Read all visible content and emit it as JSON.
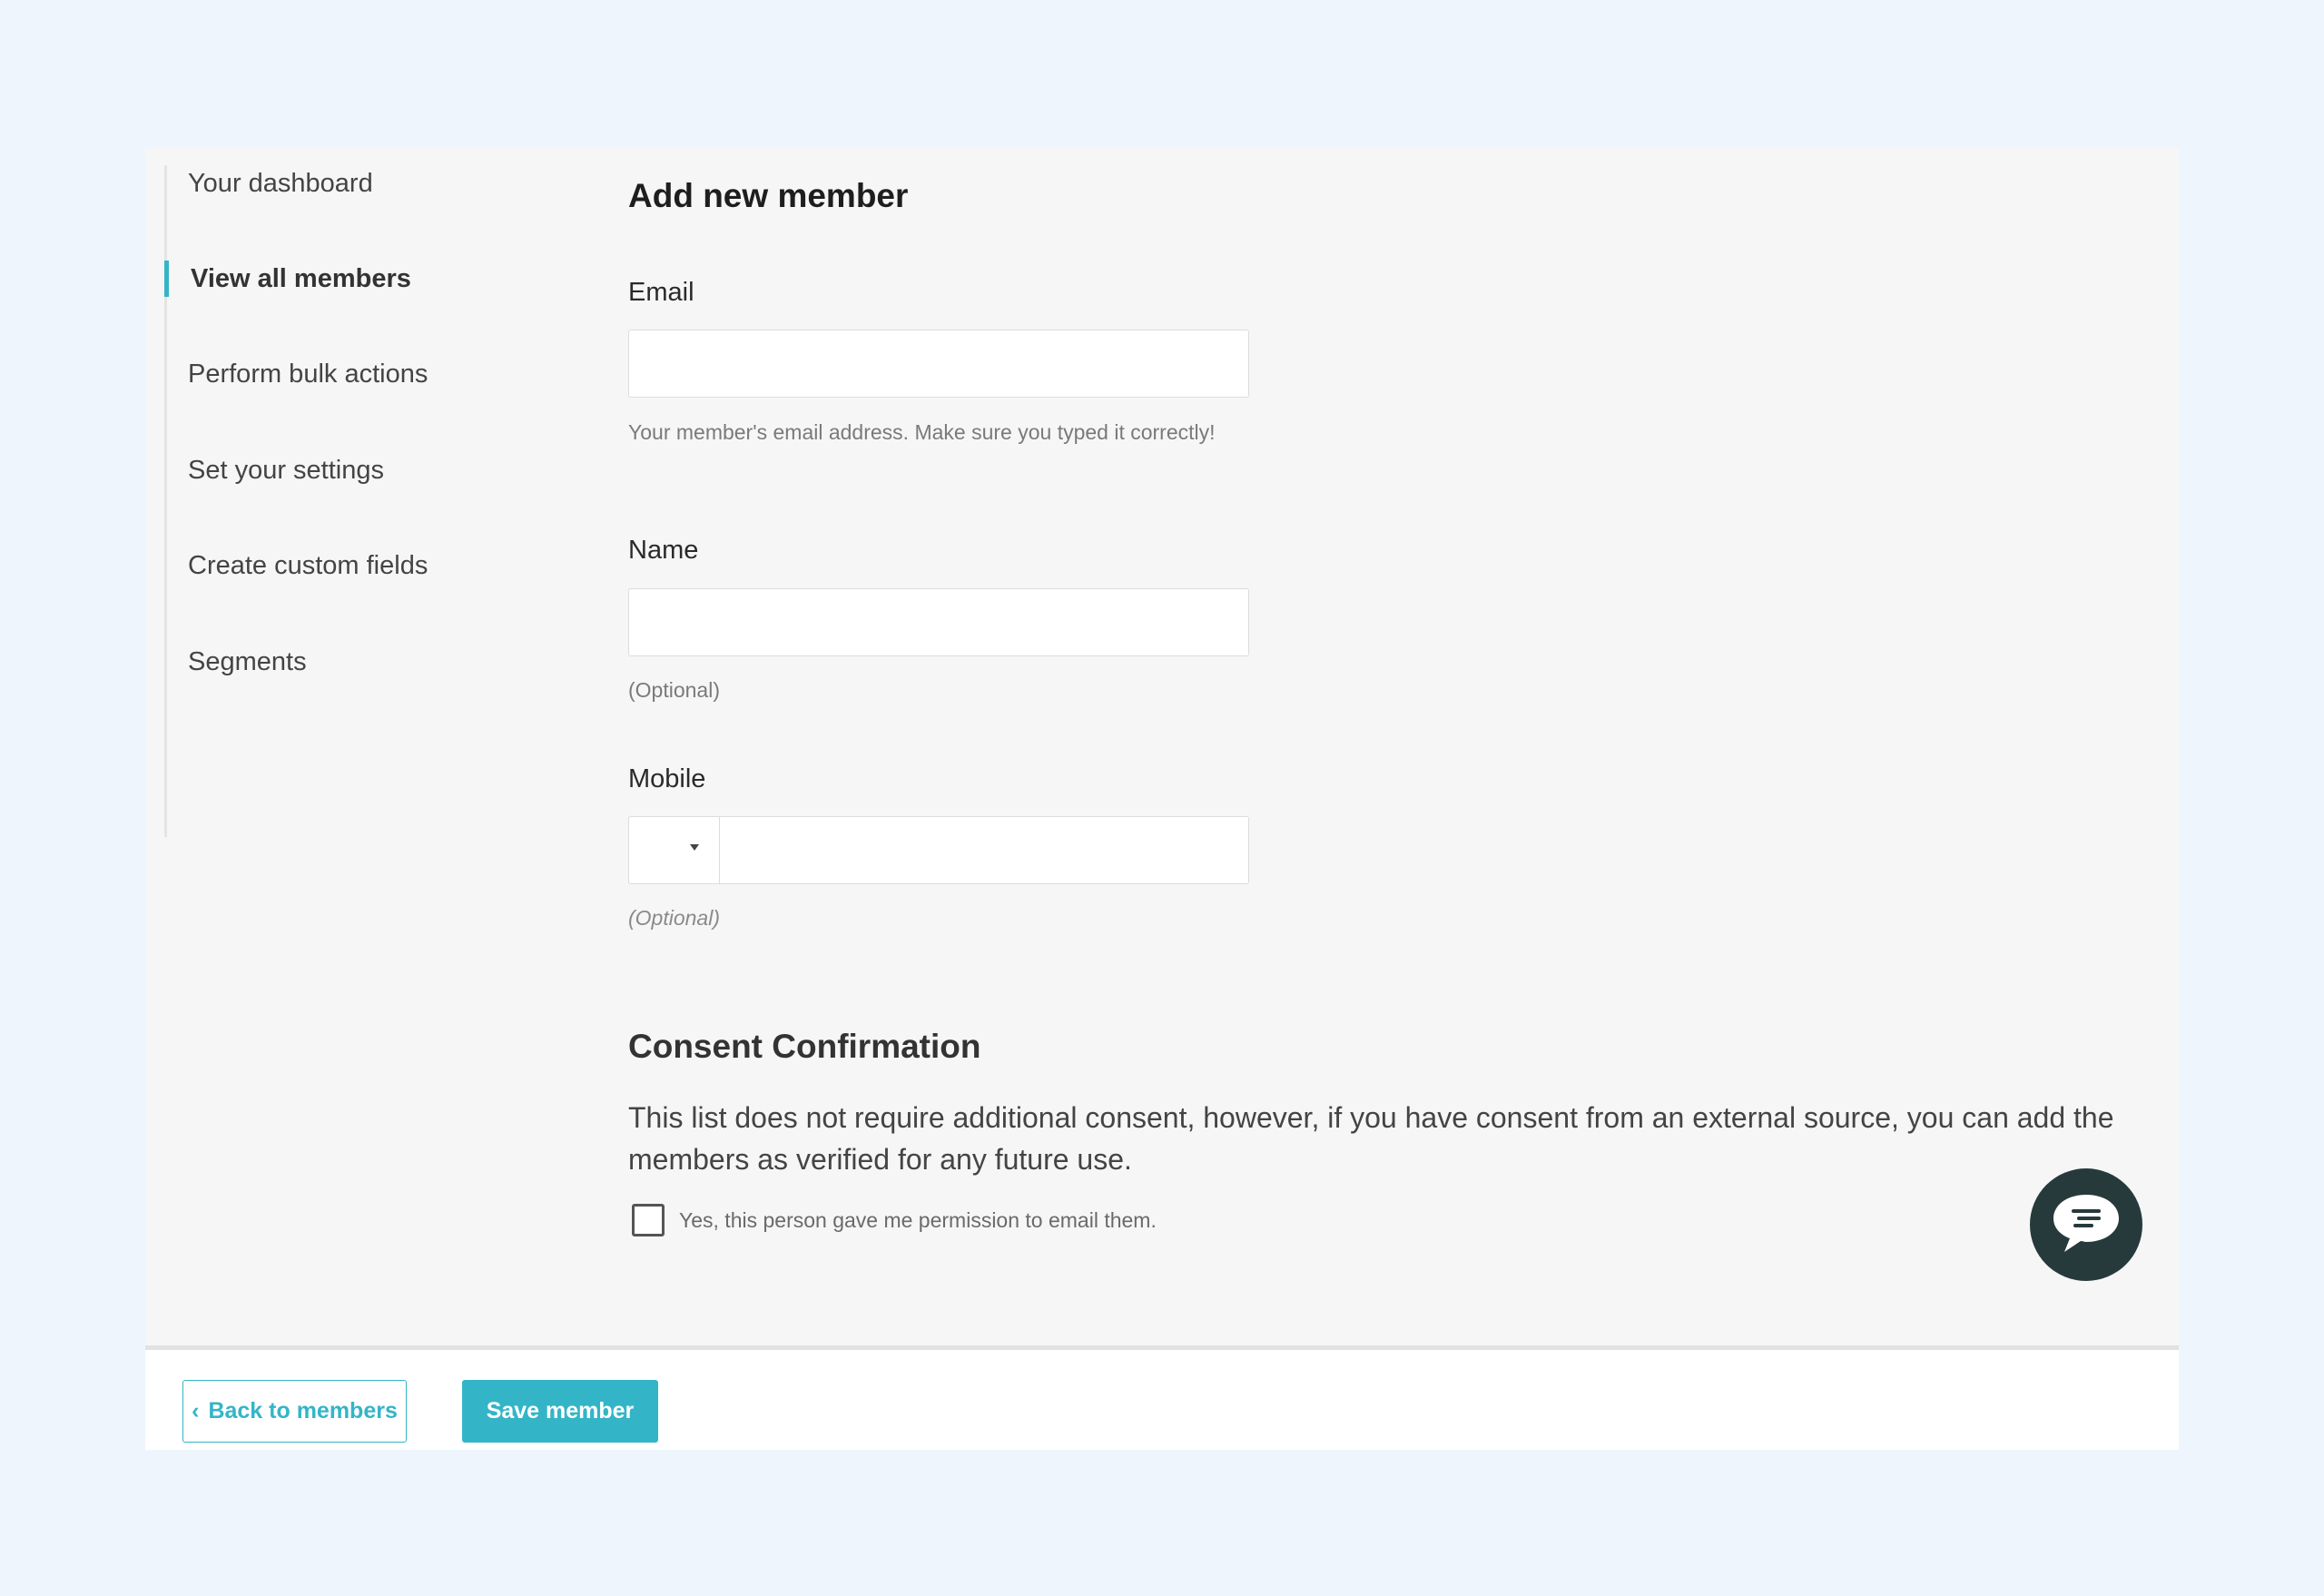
{
  "sidebar": {
    "items": [
      {
        "label": "Your dashboard",
        "active": false
      },
      {
        "label": "View all members",
        "active": true
      },
      {
        "label": "Perform bulk actions",
        "active": false
      },
      {
        "label": "Set your settings",
        "active": false
      },
      {
        "label": "Create custom fields",
        "active": false
      },
      {
        "label": "Segments",
        "active": false
      }
    ]
  },
  "form": {
    "title": "Add new member",
    "email": {
      "label": "Email",
      "value": "",
      "help": "Your member's email address. Make sure you typed it correctly!"
    },
    "name": {
      "label": "Name",
      "value": "",
      "help": "(Optional)"
    },
    "mobile": {
      "label": "Mobile",
      "country_code": "",
      "value": "",
      "help": "(Optional)"
    }
  },
  "consent": {
    "title": "Consent Confirmation",
    "text": "This list does not require additional consent, however, if you have consent from an external source, you can add the members as verified for any future use.",
    "checkbox_label": "Yes, this person gave me permission to email them.",
    "checked": false
  },
  "chat": {
    "icon": "chat-bubble-icon"
  },
  "footer": {
    "back_label": "Back to members",
    "back_icon": "chevron-left-icon",
    "save_label": "Save member"
  },
  "colors": {
    "accent": "#34b5c7",
    "page_background": "#eef5fd",
    "card_background": "#f6f6f6",
    "chat_button": "#263a3c"
  }
}
